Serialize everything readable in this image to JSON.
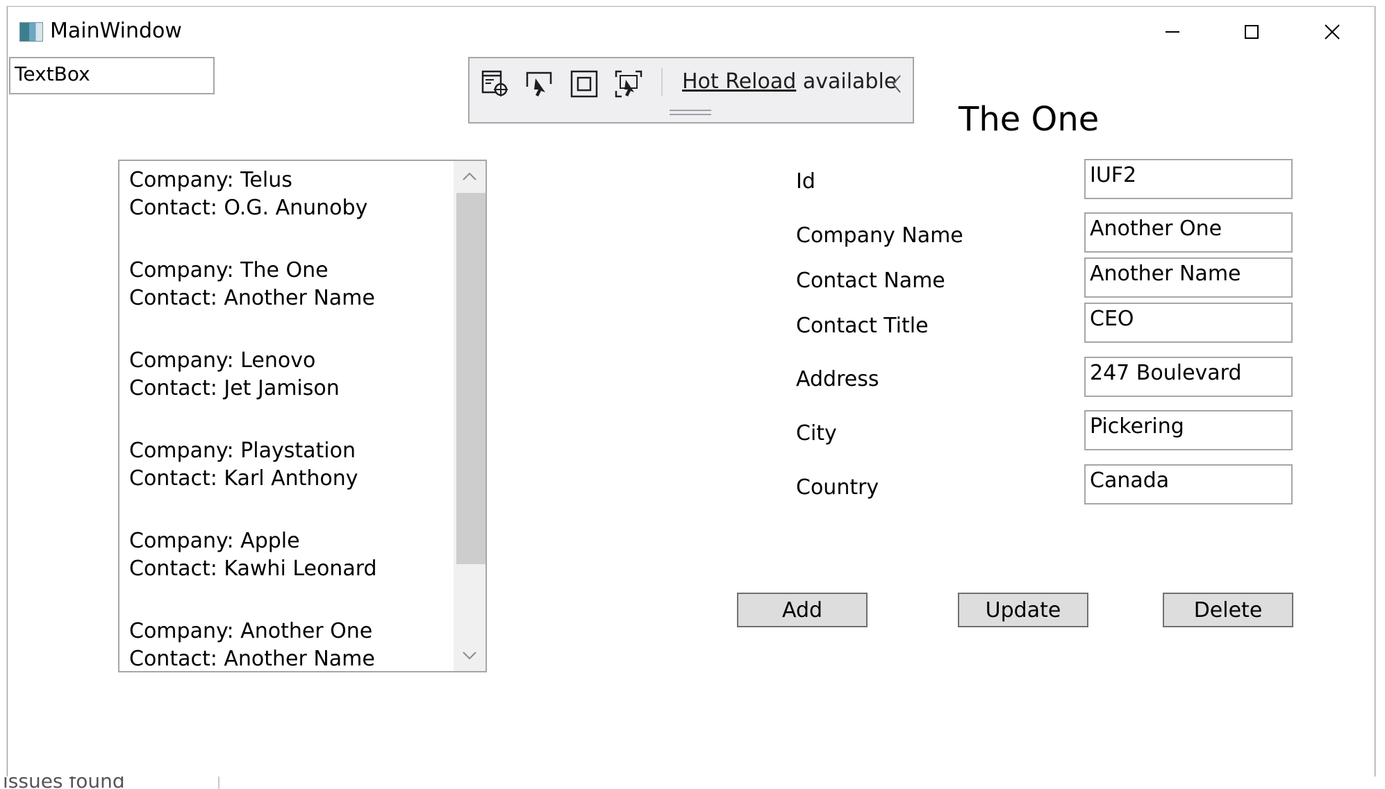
{
  "window": {
    "title": "MainWindow",
    "minimize_icon": "minimize-icon",
    "maximize_icon": "maximize-icon",
    "close_icon": "close-icon"
  },
  "textbox": {
    "value": "TextBox"
  },
  "hot_reload": {
    "link_text": "Hot Reload",
    "suffix": " available",
    "icons": [
      "select-element-icon",
      "pointer-select-icon",
      "display-layout-adorners-icon",
      "track-focused-element-icon",
      "collapse-chevron-icon"
    ]
  },
  "heading": "The One",
  "list": {
    "items": [
      {
        "company": "Company: Telus",
        "contact": "Contact: O.G. Anunoby"
      },
      {
        "company": "Company: The One",
        "contact": "Contact: Another Name"
      },
      {
        "company": "Company: Lenovo",
        "contact": "Contact: Jet Jamison"
      },
      {
        "company": "Company: Playstation",
        "contact": "Contact: Karl Anthony"
      },
      {
        "company": "Company: Apple",
        "contact": "Contact: Kawhi Leonard"
      },
      {
        "company": "Company: Another One",
        "contact": "Contact: Another Name"
      }
    ]
  },
  "form": {
    "fields": [
      {
        "label": "Id",
        "value": "IUF2"
      },
      {
        "label": "Company Name",
        "value": "Another One"
      },
      {
        "label": "Contact Name",
        "value": "Another Name"
      },
      {
        "label": "Contact Title",
        "value": "CEO"
      },
      {
        "label": "Address",
        "value": "247 Boulevard"
      },
      {
        "label": "City",
        "value": "Pickering"
      },
      {
        "label": "Country",
        "value": "Canada"
      }
    ]
  },
  "buttons": {
    "add": "Add",
    "update": "Update",
    "delete": "Delete"
  },
  "status": {
    "text": "issues found"
  },
  "colors": {
    "button_bg": "#dddddd",
    "toolbar_bg": "#efeff2",
    "scroll_thumb": "#cdcdcd"
  }
}
